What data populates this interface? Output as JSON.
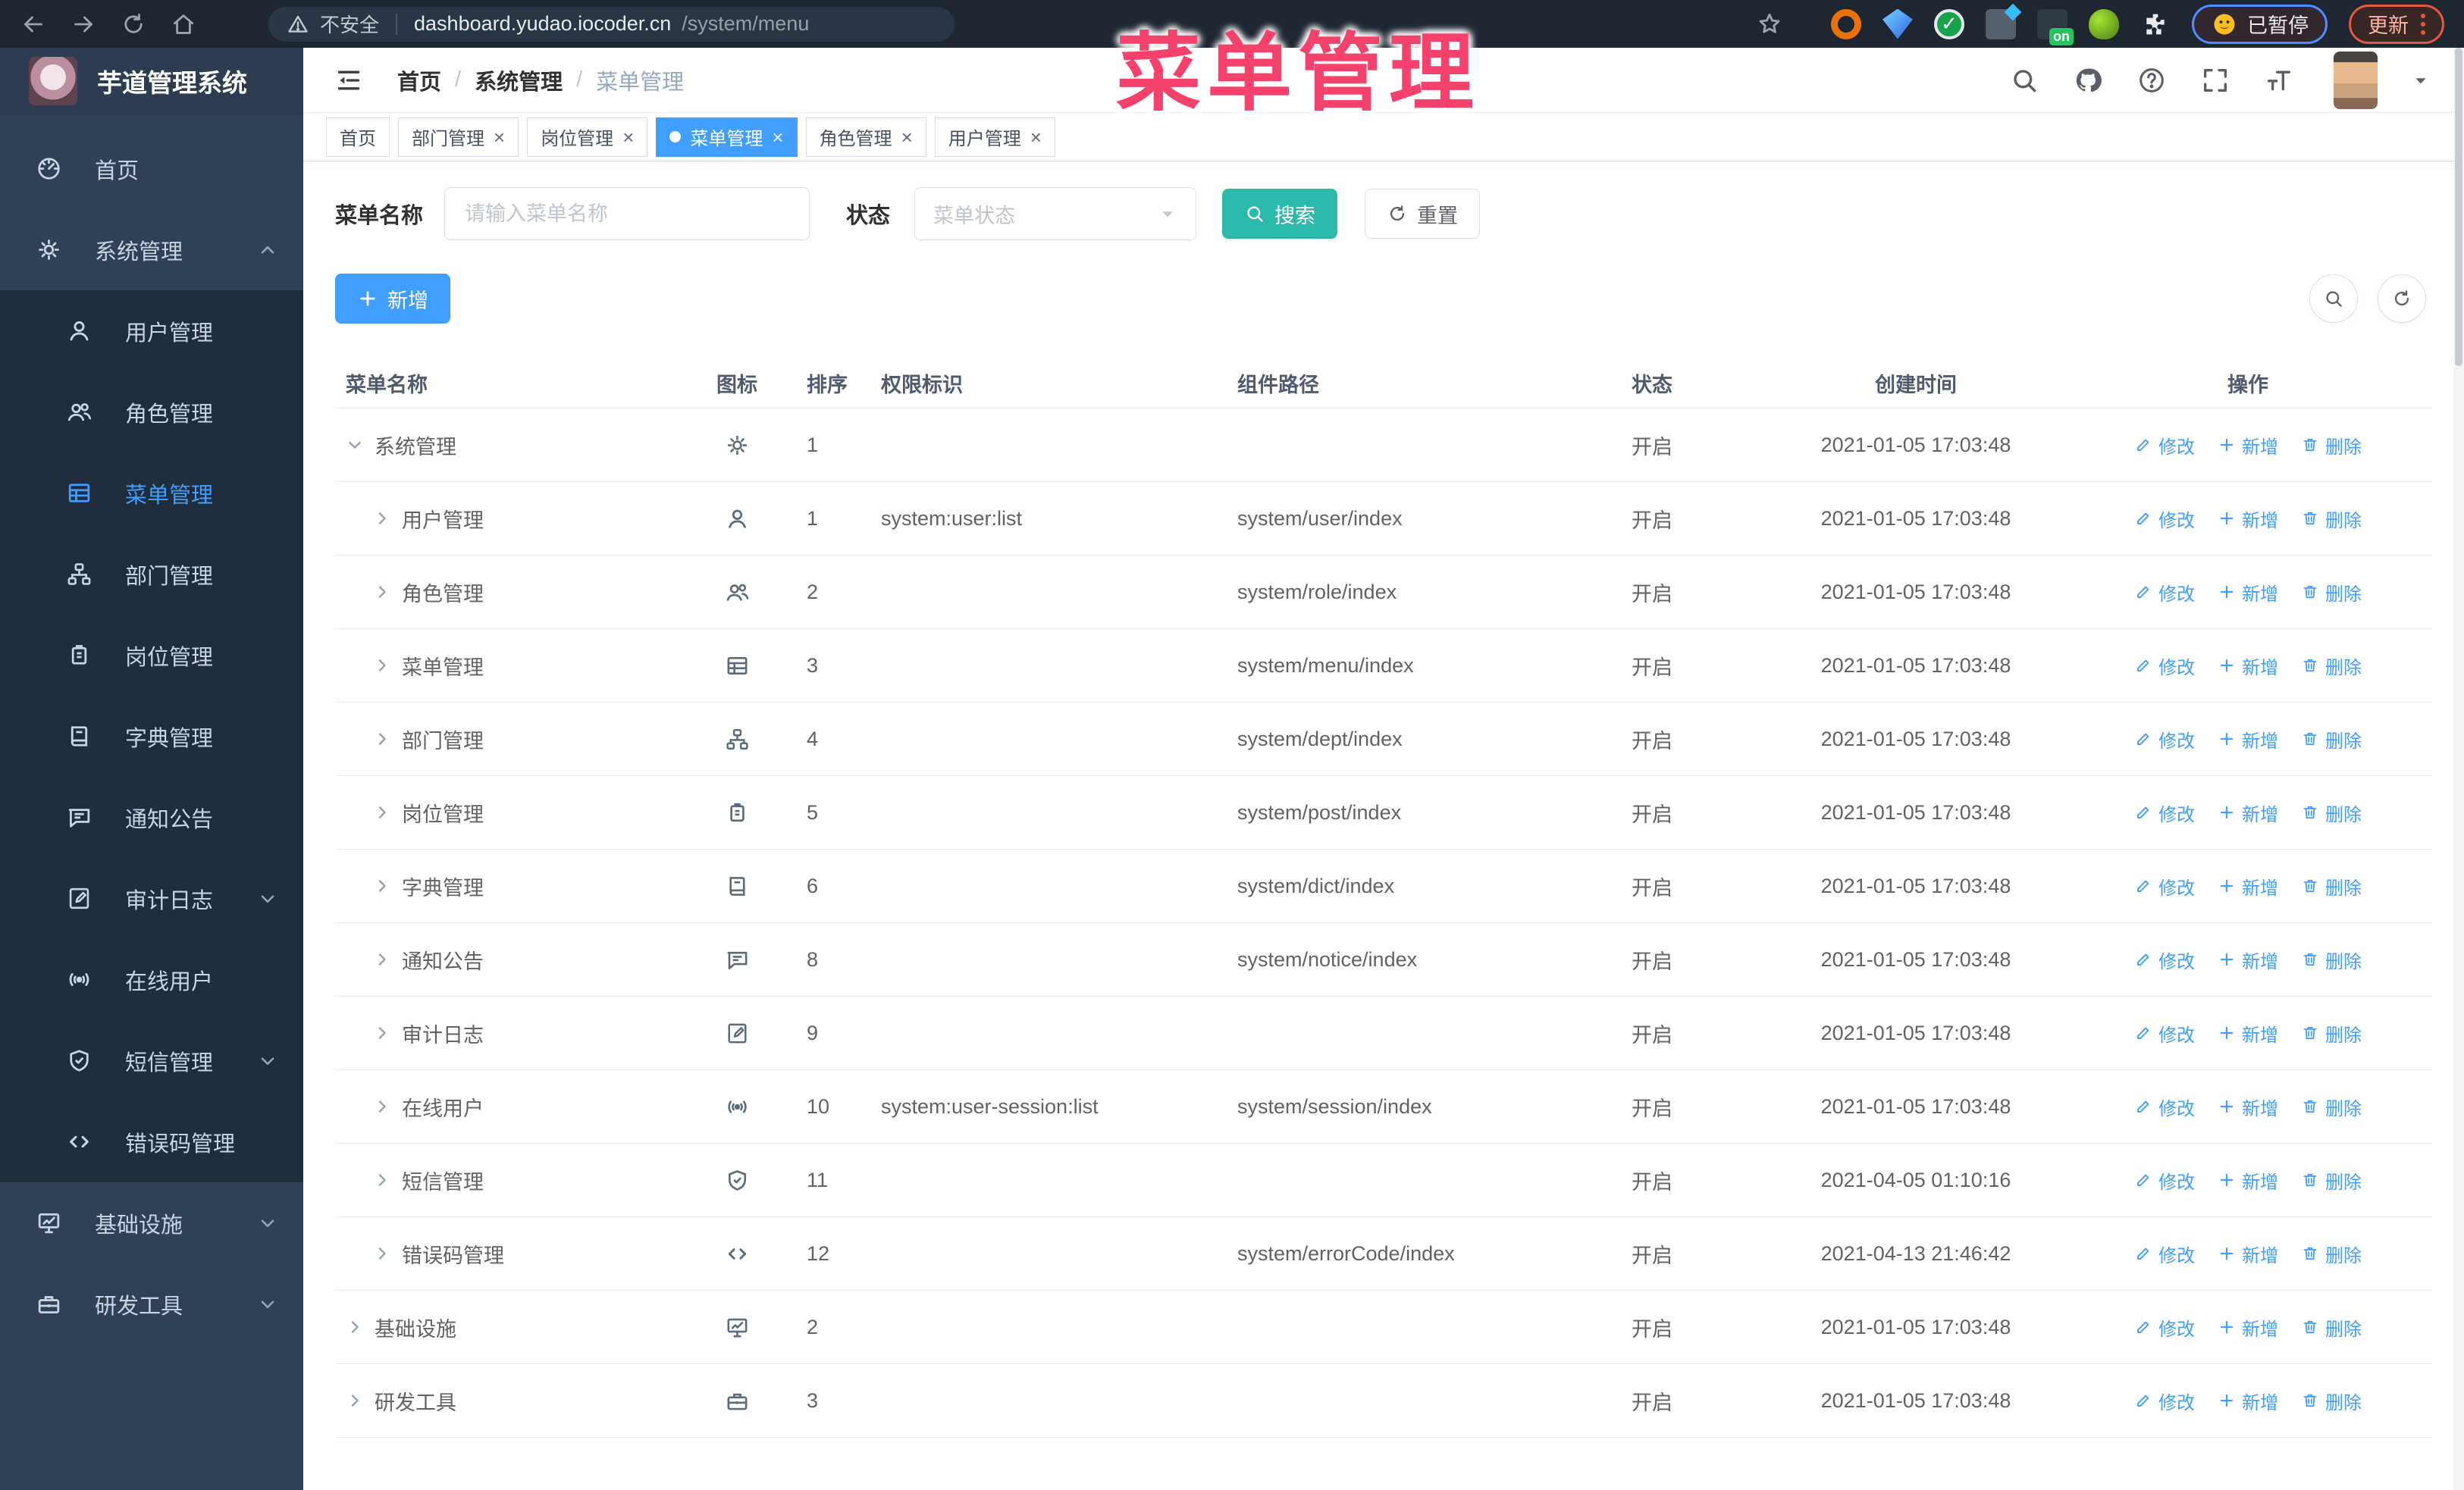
{
  "browser": {
    "security_label": "不安全",
    "url_host": "dashboard.yudao.iocoder.cn",
    "url_path": "/system/menu",
    "ext_on_badge": "on",
    "paused_label": "已暂停",
    "update_label": "更新"
  },
  "overlay_title": "菜单管理",
  "sidebar": {
    "logo_title": "芋道管理系统",
    "items": [
      {
        "label": "首页",
        "icon": "dashboard"
      },
      {
        "label": "系统管理",
        "icon": "gear",
        "has_arrow": true,
        "arrow_up": true
      },
      {
        "label": "用户管理",
        "icon": "user",
        "child": true
      },
      {
        "label": "角色管理",
        "icon": "users",
        "child": true
      },
      {
        "label": "菜单管理",
        "icon": "menu",
        "child": true,
        "active": true
      },
      {
        "label": "部门管理",
        "icon": "tree",
        "child": true
      },
      {
        "label": "岗位管理",
        "icon": "post",
        "child": true
      },
      {
        "label": "字典管理",
        "icon": "dict",
        "child": true
      },
      {
        "label": "通知公告",
        "icon": "notice",
        "child": true
      },
      {
        "label": "审计日志",
        "icon": "log",
        "child": true,
        "has_arrow": true
      },
      {
        "label": "在线用户",
        "icon": "online",
        "child": true
      },
      {
        "label": "短信管理",
        "icon": "sms",
        "child": true,
        "has_arrow": true
      },
      {
        "label": "错误码管理",
        "icon": "code",
        "child": true
      },
      {
        "label": "基础设施",
        "icon": "infra",
        "has_arrow": true
      },
      {
        "label": "研发工具",
        "icon": "tool",
        "has_arrow": true
      }
    ]
  },
  "header": {
    "breadcrumb": [
      "首页",
      "系统管理",
      "菜单管理"
    ]
  },
  "tabs": [
    {
      "label": "首页"
    },
    {
      "label": "部门管理",
      "closable": true
    },
    {
      "label": "岗位管理",
      "closable": true
    },
    {
      "label": "菜单管理",
      "closable": true,
      "active": true
    },
    {
      "label": "角色管理",
      "closable": true
    },
    {
      "label": "用户管理",
      "closable": true
    }
  ],
  "filters": {
    "name_label": "菜单名称",
    "name_placeholder": "请输入菜单名称",
    "status_label": "状态",
    "status_placeholder": "菜单状态",
    "search_label": "搜索",
    "reset_label": "重置"
  },
  "toolbar": {
    "add_label": "新增"
  },
  "ops": {
    "edit": "修改",
    "add": "新增",
    "del": "删除"
  },
  "ui": {
    "close_glyph": "×",
    "check_glyph": "✓"
  },
  "table": {
    "columns": [
      "菜单名称",
      "图标",
      "排序",
      "权限标识",
      "组件路径",
      "状态",
      "创建时间",
      "操作"
    ],
    "rows": [
      {
        "name": "系统管理",
        "icon": "gear",
        "sort": "1",
        "perm": "",
        "path": "",
        "status": "开启",
        "time": "2021-01-05 17:03:48",
        "expanded": true
      },
      {
        "name": "用户管理",
        "icon": "user",
        "sort": "1",
        "perm": "system:user:list",
        "path": "system/user/index",
        "status": "开启",
        "time": "2021-01-05 17:03:48",
        "child": true
      },
      {
        "name": "角色管理",
        "icon": "users",
        "sort": "2",
        "perm": "",
        "path": "system/role/index",
        "status": "开启",
        "time": "2021-01-05 17:03:48",
        "child": true
      },
      {
        "name": "菜单管理",
        "icon": "menu",
        "sort": "3",
        "perm": "",
        "path": "system/menu/index",
        "status": "开启",
        "time": "2021-01-05 17:03:48",
        "child": true
      },
      {
        "name": "部门管理",
        "icon": "tree",
        "sort": "4",
        "perm": "",
        "path": "system/dept/index",
        "status": "开启",
        "time": "2021-01-05 17:03:48",
        "child": true
      },
      {
        "name": "岗位管理",
        "icon": "post",
        "sort": "5",
        "perm": "",
        "path": "system/post/index",
        "status": "开启",
        "time": "2021-01-05 17:03:48",
        "child": true
      },
      {
        "name": "字典管理",
        "icon": "dict",
        "sort": "6",
        "perm": "",
        "path": "system/dict/index",
        "status": "开启",
        "time": "2021-01-05 17:03:48",
        "child": true
      },
      {
        "name": "通知公告",
        "icon": "notice",
        "sort": "8",
        "perm": "",
        "path": "system/notice/index",
        "status": "开启",
        "time": "2021-01-05 17:03:48",
        "child": true
      },
      {
        "name": "审计日志",
        "icon": "log",
        "sort": "9",
        "perm": "",
        "path": "",
        "status": "开启",
        "time": "2021-01-05 17:03:48",
        "child": true
      },
      {
        "name": "在线用户",
        "icon": "online",
        "sort": "10",
        "perm": "system:user-session:list",
        "path": "system/session/index",
        "status": "开启",
        "time": "2021-01-05 17:03:48",
        "child": true
      },
      {
        "name": "短信管理",
        "icon": "sms",
        "sort": "11",
        "perm": "",
        "path": "",
        "status": "开启",
        "time": "2021-04-05 01:10:16",
        "child": true
      },
      {
        "name": "错误码管理",
        "icon": "code",
        "sort": "12",
        "perm": "",
        "path": "system/errorCode/index",
        "status": "开启",
        "time": "2021-04-13 21:46:42",
        "child": true
      },
      {
        "name": "基础设施",
        "icon": "infra",
        "sort": "2",
        "perm": "",
        "path": "",
        "status": "开启",
        "time": "2021-01-05 17:03:48"
      },
      {
        "name": "研发工具",
        "icon": "tool",
        "sort": "3",
        "perm": "",
        "path": "",
        "status": "开启",
        "time": "2021-01-05 17:03:48"
      }
    ]
  },
  "colors": {
    "primary": "#409eff",
    "teal": "#2bb9aa",
    "overlay_pink": "#f5426c",
    "sidebar_bg": "#304156",
    "submenu_bg": "#1f2d3d"
  }
}
